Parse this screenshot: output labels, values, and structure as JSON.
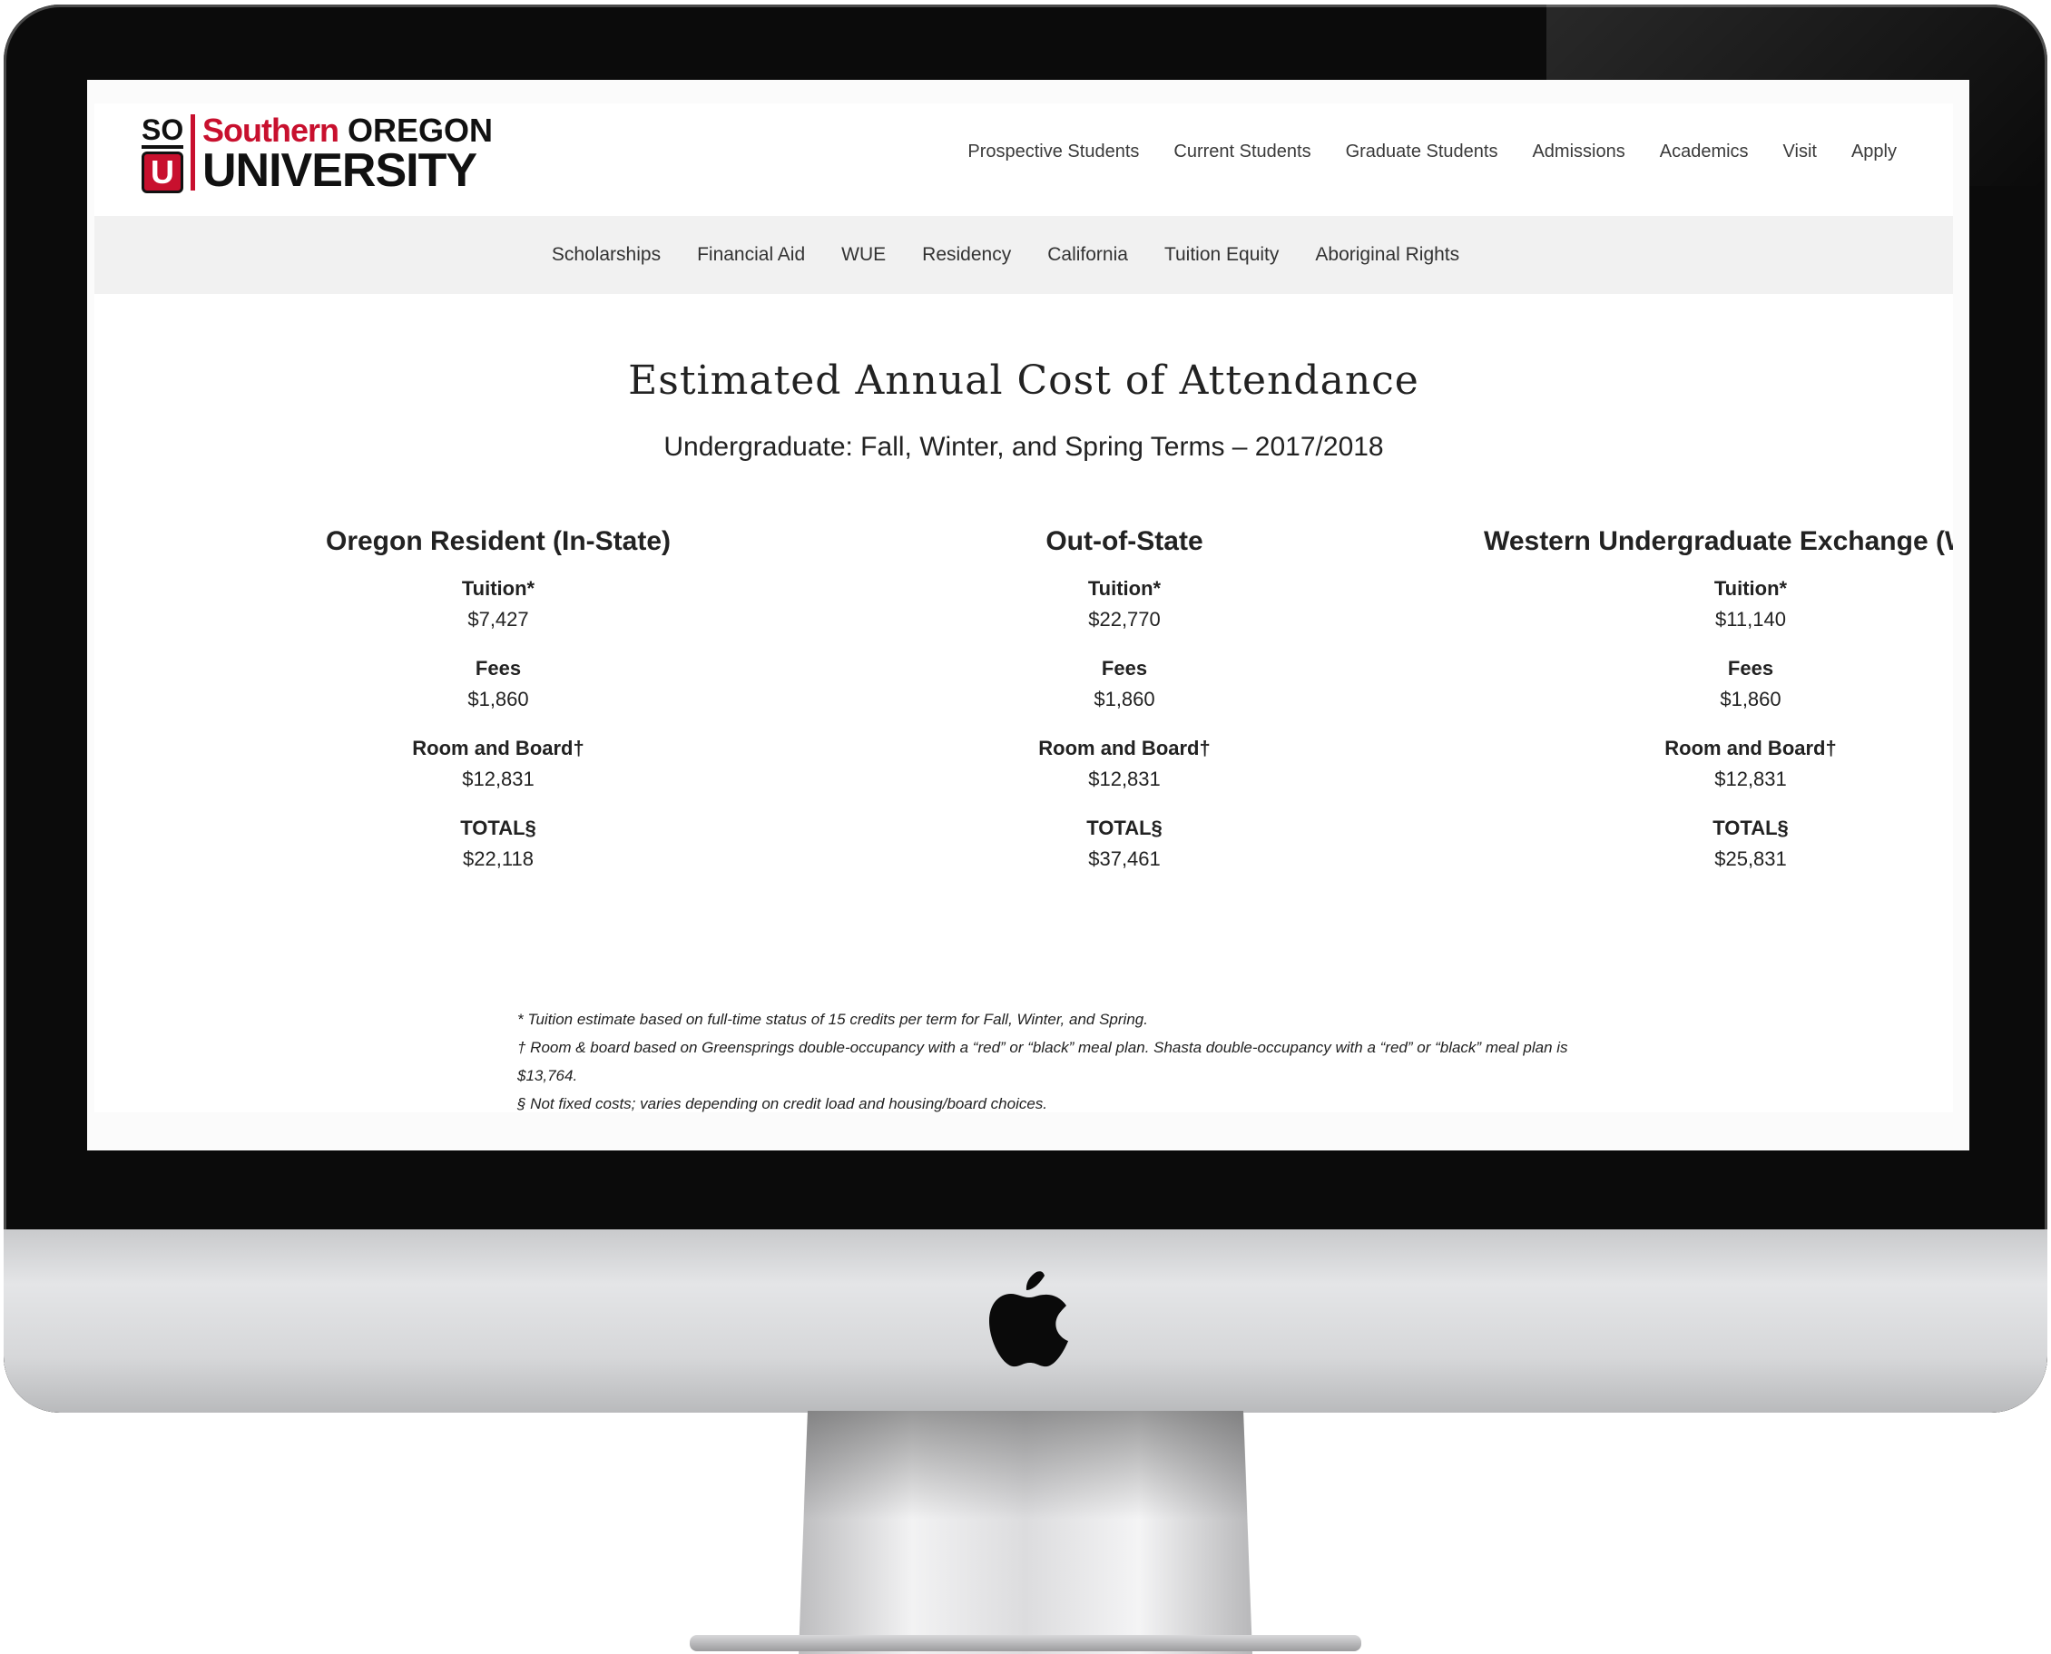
{
  "logo": {
    "badge_top": "SO",
    "badge_bottom": "U",
    "line1_red": "Southern",
    "line1_black": "OREGON",
    "line2": "UNIVERSITY"
  },
  "main_nav": [
    "Prospective Students",
    "Current Students",
    "Graduate Students",
    "Admissions",
    "Academics",
    "Visit",
    "Apply"
  ],
  "sub_nav": [
    "Scholarships",
    "Financial Aid",
    "WUE",
    "Residency",
    "California",
    "Tuition Equity",
    "Aboriginal Rights"
  ],
  "content": {
    "title": "Estimated Annual Cost of Attendance",
    "subtitle": "Undergraduate: Fall, Winter, and Spring Terms – 2017/2018",
    "columns": [
      {
        "heading": "Oregon Resident (In-State)",
        "tuition_label": "Tuition*",
        "tuition": "$7,427",
        "fees_label": "Fees",
        "fees": "$1,860",
        "room_label": "Room and Board†",
        "room": "$12,831",
        "total_label": "TOTAL§",
        "total": "$22,118"
      },
      {
        "heading": "Out-of-State",
        "tuition_label": "Tuition*",
        "tuition": "$22,770",
        "fees_label": "Fees",
        "fees": "$1,860",
        "room_label": "Room and Board†",
        "room": "$12,831",
        "total_label": "TOTAL§",
        "total": "$37,461"
      },
      {
        "heading": "Western Undergraduate Exchange (WUE)",
        "tuition_label": "Tuition*",
        "tuition": "$11,140",
        "fees_label": "Fees",
        "fees": "$1,860",
        "room_label": "Room and Board†",
        "room": "$12,831",
        "total_label": "TOTAL§",
        "total": "$25,831"
      }
    ],
    "footnotes": [
      "* Tuition estimate based on full-time status of 15 credits per term for Fall, Winter, and Spring.",
      "† Room & board based on Greensprings double-occupancy with a “red” or “black” meal plan. Shasta double-occupancy with a “red” or “black” meal plan is $13,764.",
      "§ Not fixed costs; varies depending on credit load and housing/board choices."
    ]
  },
  "colors": {
    "brand_red": "#c8102e",
    "subnav_bg": "#f1f1f1",
    "bezel": "#0b0b0b"
  },
  "icons": {
    "hardware_logo": "apple-logo-icon"
  }
}
